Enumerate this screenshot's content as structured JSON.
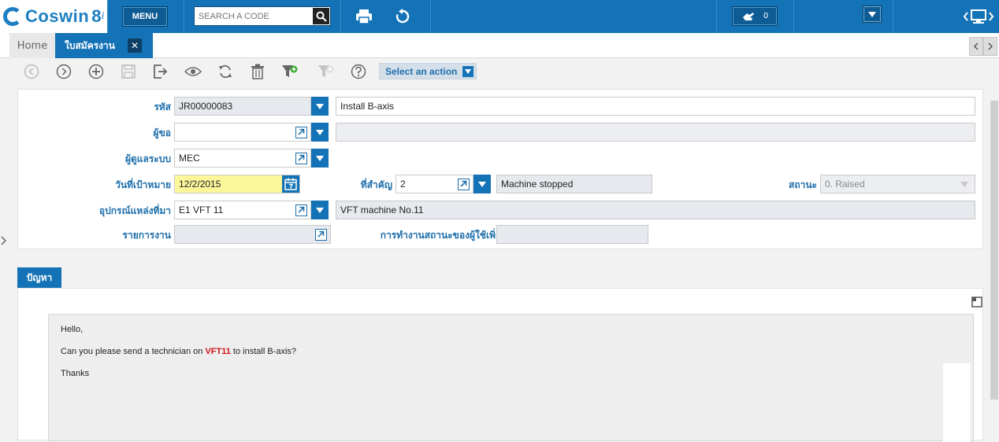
{
  "topbar": {
    "logo_text": "Coswin",
    "logo_version": "8",
    "logo_suffix": "i",
    "menu_label": "MENU",
    "search_placeholder": "SEARCH A CODE",
    "notifications_count": "0"
  },
  "tabs": {
    "home_label": "Home",
    "active_label": "ใบสมัครงาน",
    "close_glyph": "✕"
  },
  "toolbar": {
    "select_action_label": "Select an action"
  },
  "form": {
    "code_label": "รหัส",
    "code_value": "JR00000083",
    "description_value": "Install B-axis",
    "requester_label": "ผู้ขอ",
    "requester_value": "",
    "requester_name": "",
    "sysadmin_label": "ผู้ดูแลระบบ",
    "sysadmin_value": "MEC",
    "target_date_label": "วันที่เป้าหมาย",
    "target_date_value": "12/2/2015",
    "priority_label": "ที่สำคัญ",
    "priority_value": "2",
    "priority_desc": "Machine stopped",
    "status_label": "สถานะ",
    "status_value": "0. Raised",
    "source_equipment_label": "อุปกรณ์แหล่งที่มา",
    "source_equipment_value": "E1 VFT 11",
    "source_equipment_desc": "VFT machine No.11",
    "work_list_label": "รายการงาน",
    "work_list_value": "",
    "user_status_label": "การทำงานสถานะของผู้ใช้เพิ่",
    "user_status_value": ""
  },
  "problem": {
    "tab_label": "ปัญหา",
    "greeting": "Hello,",
    "body_before": "Can you please send a technician on ",
    "body_highlight": "VFT11",
    "body_after": " to install B-axis?",
    "sign_off": "Thanks"
  },
  "colors": {
    "primary": "#1473b6",
    "label_blue": "#1e6eab",
    "highlight_red": "#d0131b",
    "date_yellow": "#fbf79a"
  }
}
